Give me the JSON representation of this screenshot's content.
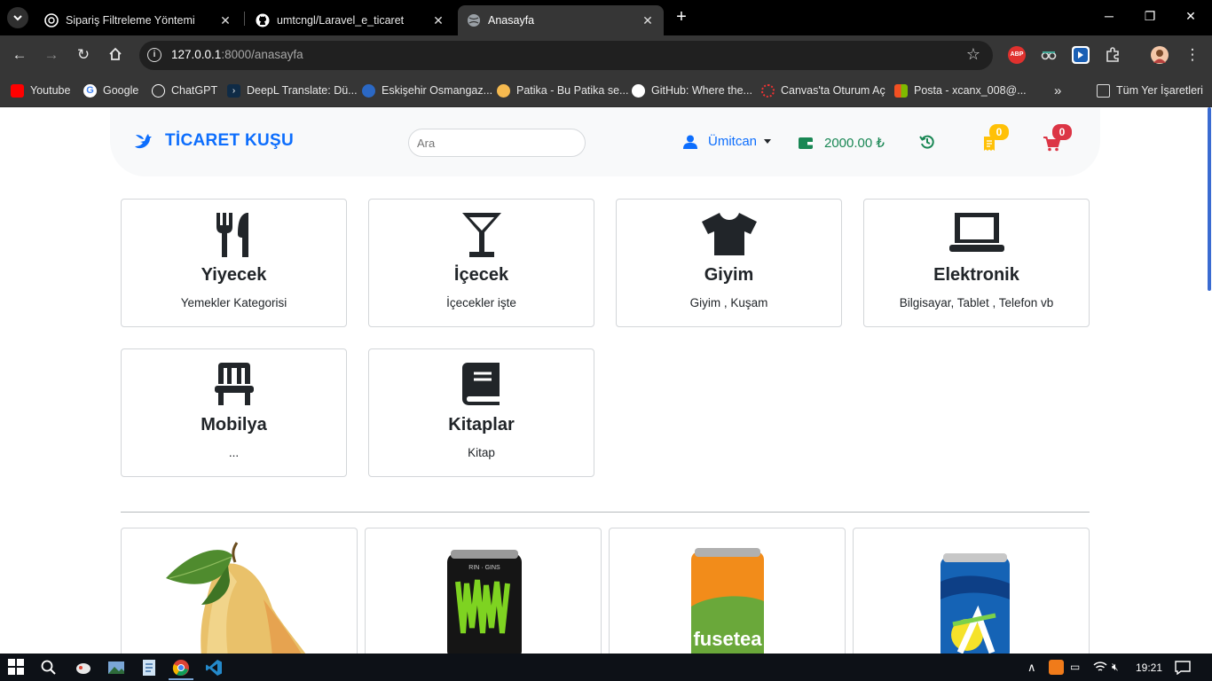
{
  "browser": {
    "tabs": [
      {
        "title": "Sipariş Filtreleme Yöntemi"
      },
      {
        "title": "umtcngl/Laravel_e_ticaret"
      },
      {
        "title": "Anasayfa"
      }
    ],
    "url_host": "127.0.0.1",
    "url_rest": ":8000/anasayfa",
    "bookmarks": [
      {
        "label": "Youtube"
      },
      {
        "label": "Google"
      },
      {
        "label": "ChatGPT"
      },
      {
        "label": "DeepL Translate: Dü..."
      },
      {
        "label": "Eskişehir Osmangaz..."
      },
      {
        "label": "Patika - Bu Patika se..."
      },
      {
        "label": "GitHub: Where the..."
      },
      {
        "label": "Canvas'ta Oturum Aç"
      },
      {
        "label": "Posta - xcanx_008@..."
      }
    ],
    "all_bookmarks": "Tüm Yer İşaretleri",
    "more_bookmarks": "»"
  },
  "navbar": {
    "brand": "TİCARET KUŞU",
    "search_placeholder": "Ara",
    "user": "Ümitcan",
    "balance": "2000.00 ₺",
    "orders_badge": "0",
    "cart_badge": "0"
  },
  "categories": [
    {
      "title": "Yiyecek",
      "desc": "Yemekler Kategorisi",
      "icon": "utensils-icon"
    },
    {
      "title": "İçecek",
      "desc": "İçecekler işte",
      "icon": "martini-glass-icon"
    },
    {
      "title": "Giyim",
      "desc": "Giyim , Kuşam",
      "icon": "shirt-icon"
    },
    {
      "title": "Elektronik",
      "desc": "Bilgisayar, Tablet , Telefon vb",
      "icon": "laptop-icon"
    },
    {
      "title": "Mobilya",
      "desc": "...",
      "icon": "chair-icon"
    },
    {
      "title": "Kitaplar",
      "desc": "Kitap",
      "icon": "book-icon"
    }
  ],
  "products": [
    {
      "image": "pear-image"
    },
    {
      "image": "monster-energy-can-image"
    },
    {
      "image": "fuse-tea-can-image"
    },
    {
      "image": "sprite-can-image"
    }
  ],
  "taskbar": {
    "clock": "19:21"
  },
  "colors": {
    "primary": "#0d6efd",
    "success": "#198754",
    "warning": "#ffc107",
    "danger": "#dc3545"
  }
}
